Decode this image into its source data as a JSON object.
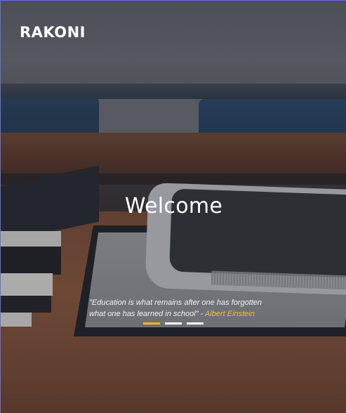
{
  "brand": {
    "logo_text": "RAKONI"
  },
  "hero": {
    "headline": "Welcome",
    "quote_text": "\"Education is what remains after one has forgotten what one has learned in school\" - ",
    "quote_author": "Albert Einstein"
  },
  "slider": {
    "total_slides": 3,
    "active_index": 0,
    "indicators": [
      {
        "label": "slide 1",
        "active": true
      },
      {
        "label": "slide 2",
        "active": false
      },
      {
        "label": "slide 3",
        "active": false
      }
    ]
  },
  "colors": {
    "accent": "#f0b31a",
    "author": "#f0c22f",
    "text": "#ffffff"
  }
}
